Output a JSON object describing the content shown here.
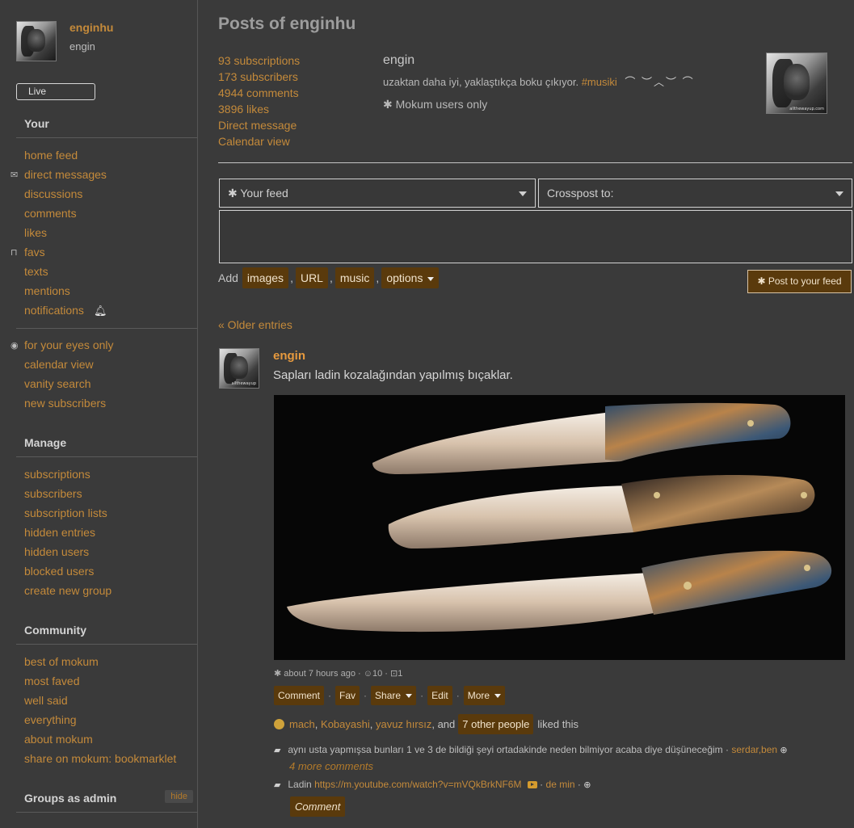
{
  "sidebar": {
    "username": "enginhu",
    "realname": "engin",
    "live_label": "Live",
    "your": {
      "heading": "Your",
      "items": [
        "home feed",
        "direct messages",
        "discussions",
        "comments",
        "likes",
        "favs",
        "texts",
        "mentions",
        "notifications"
      ],
      "items2": [
        "for your eyes only",
        "calendar view",
        "vanity search",
        "new subscribers"
      ]
    },
    "manage": {
      "heading": "Manage",
      "items": [
        "subscriptions",
        "subscribers",
        "subscription lists",
        "hidden entries",
        "hidden users",
        "blocked users",
        "create new group"
      ]
    },
    "community": {
      "heading": "Community",
      "items": [
        "best of mokum",
        "most faved",
        "well said",
        "everything",
        "about mokum",
        "share on mokum: bookmarklet"
      ]
    },
    "groups_admin": {
      "heading": "Groups as admin",
      "hide_label": "hide"
    }
  },
  "profile": {
    "page_title": "Posts of enginhu",
    "stats": [
      "93 subscriptions",
      "173 subscribers",
      "4944 comments",
      "3896 likes",
      "Direct message",
      "Calendar view"
    ],
    "name": "engin",
    "description": "uzaktan daha iyi, yaklaştıkça boku çıkıyor.",
    "hashtag": "#musiki",
    "description_arcs": "⌒ ︶︿︶ ⌒",
    "note": "✱ Mokum users only"
  },
  "composer": {
    "feed_select": "✱ Your feed",
    "crosspost_select": "Crosspost to:",
    "add_label": "Add",
    "add_options": [
      "images",
      "URL",
      "music",
      "options"
    ],
    "post_button": "✱ Post to your feed"
  },
  "older_entries": "« Older entries",
  "entry": {
    "author": "engin",
    "text": "Sapları ladin kozalağından yapılmış bıçaklar.",
    "meta": "✱ about 7 hours ago · ☺10 · ⊡1",
    "actions": [
      "Comment",
      "Fav",
      "Share",
      "Edit",
      "More"
    ],
    "likers": [
      "mach",
      "Kobayashi",
      "yavuz hırsız"
    ],
    "likes_and": ", and",
    "likes_others": "7 other people",
    "likes_suffix": "liked this",
    "comment1_text": "aynı usta yapmışsa bunları 1 ve 3 de bildiği şeyi ortadakinde neden bilmiyor acaba diye düşüneceğim ·",
    "comment1_author": "serdar,ben",
    "more_comments": "4 more comments",
    "comment2_prefix": "Ladin",
    "comment2_link": "https://m.youtube.com/watch?v=mVQkBrkNF6M",
    "comment2_author": "de min",
    "comment_button": "Comment"
  },
  "colors": {
    "background": "#3a3a3a",
    "link": "#c48a3a",
    "button_bg": "#5a3a0c",
    "author": "#e79a3e"
  }
}
